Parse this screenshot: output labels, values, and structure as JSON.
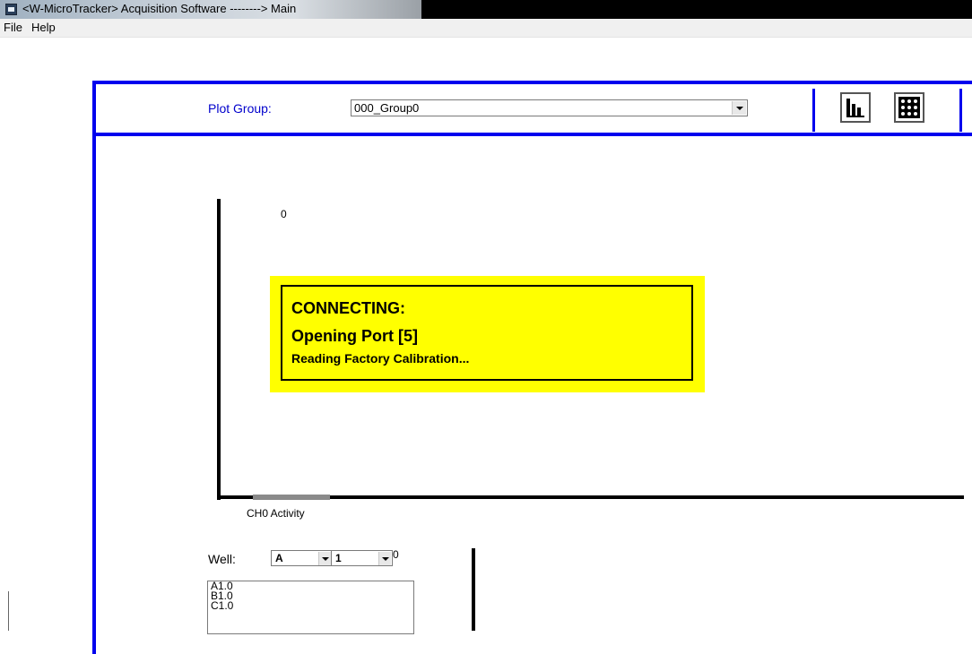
{
  "window": {
    "title": "<W-MicroTracker> Acquisition Software --------> Main"
  },
  "menu": {
    "items": [
      "File",
      "Help"
    ]
  },
  "toolbar": {
    "plot_group_label": "Plot Group:",
    "plot_group_value": "000_Group0",
    "buttons": [
      "bar-chart-icon",
      "well-grid-icon"
    ]
  },
  "plot": {
    "y_zero": "0",
    "channel_label": "CH0 Activity"
  },
  "status": {
    "title": "CONNECTING:",
    "port": "Opening Port [5]",
    "message": "Reading Factory Calibration..."
  },
  "well": {
    "label": "Well:",
    "row_value": "A",
    "col_value": "1",
    "zero": "0",
    "list": [
      "A1.0",
      "B1.0",
      "C1.0"
    ]
  },
  "colors": {
    "frame": "#0000ee",
    "status_bg": "#ffff00"
  }
}
